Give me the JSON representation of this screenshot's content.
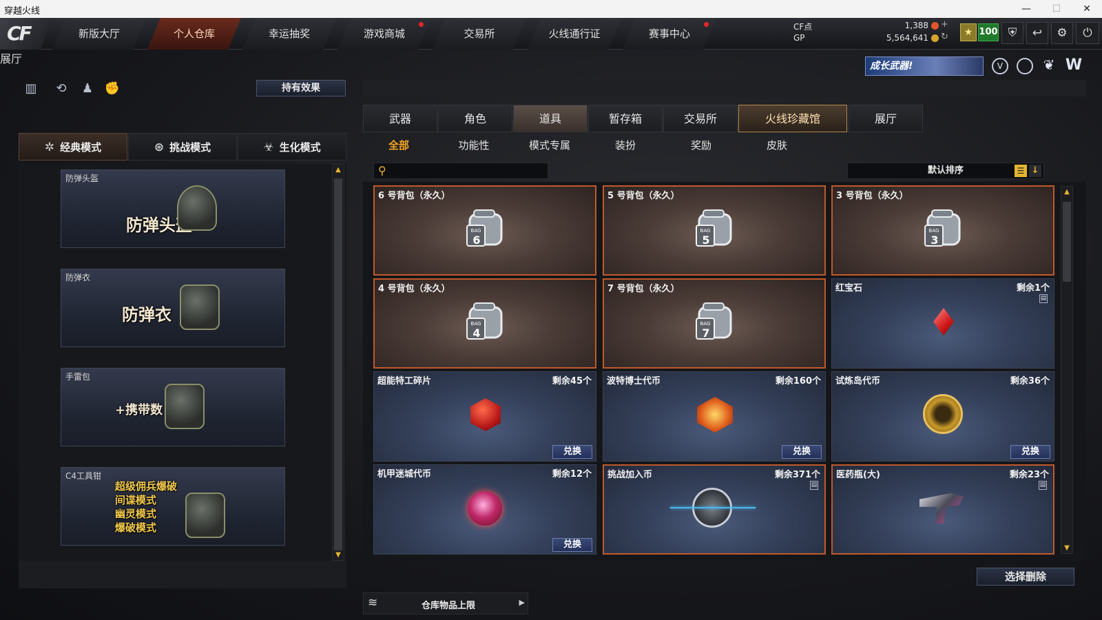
{
  "window": {
    "title": "穿越火线",
    "controls": {
      "minimize": "—",
      "maximize": "☐",
      "close": "✕"
    }
  },
  "logo": {
    "text": "CF"
  },
  "nav": {
    "tabs": [
      {
        "label": "新版大厅",
        "active": false,
        "dot": false
      },
      {
        "label": "个人仓库",
        "active": true,
        "dot": false
      },
      {
        "label": "幸运抽奖",
        "active": false,
        "dot": false
      },
      {
        "label": "游戏商城",
        "active": false,
        "dot": true
      },
      {
        "label": "交易所",
        "active": false,
        "dot": false
      },
      {
        "label": "火线通行证",
        "active": false,
        "dot": false
      },
      {
        "label": "赛事中心",
        "active": false,
        "dot": true
      }
    ]
  },
  "currency": {
    "cf_label": "CF点",
    "cf_value": "1,388",
    "gp_label": "GP",
    "gp_value": "5,564,641",
    "plus": "+",
    "level": "100"
  },
  "banner": {
    "text": "成长武器!"
  },
  "left": {
    "effect_button": "持有效果",
    "tabs": [
      {
        "label": "背包",
        "selected": false
      },
      {
        "label": "角色",
        "selected": false
      },
      {
        "label": "功能道具",
        "selected": true
      },
      {
        "label": "展厅",
        "selected": false
      }
    ],
    "modes": [
      {
        "label": "经典模式",
        "icon": "✲",
        "selected": true
      },
      {
        "label": "挑战模式",
        "icon": "⊛",
        "selected": false
      },
      {
        "label": "生化模式",
        "icon": "☣",
        "selected": false
      }
    ],
    "cards": [
      {
        "caption": "防弹头盔",
        "title": "防弹头盔"
      },
      {
        "caption": "防弹衣",
        "title": "防弹衣"
      },
      {
        "caption": "手雷包",
        "title": "+携带数"
      },
      {
        "caption": "C4工具钳",
        "lines": [
          "超级佣兵爆破",
          "间谍模式",
          "幽灵模式",
          "爆破模式"
        ]
      }
    ]
  },
  "right": {
    "tabs": [
      {
        "label": "武器",
        "style": ""
      },
      {
        "label": "角色",
        "style": ""
      },
      {
        "label": "道具",
        "style": "sel"
      },
      {
        "label": "暂存箱",
        "style": ""
      },
      {
        "label": "交易所",
        "style": ""
      },
      {
        "label": "火线珍藏馆",
        "style": "gold"
      },
      {
        "label": "展厅",
        "style": ""
      }
    ],
    "subtabs": [
      {
        "label": "全部",
        "selected": true
      },
      {
        "label": "功能性",
        "selected": false
      },
      {
        "label": "模式专属",
        "selected": false
      },
      {
        "label": "装扮",
        "selected": false
      },
      {
        "label": "奖励",
        "selected": false
      },
      {
        "label": "皮肤",
        "selected": false
      }
    ],
    "search_placeholder": "",
    "sort_label": "默认排序",
    "items": [
      {
        "name": "6 号背包（永久）",
        "remaining": "",
        "type": "bag",
        "bag": "6",
        "exchange": ""
      },
      {
        "name": "5 号背包（永久）",
        "remaining": "",
        "type": "bag",
        "bag": "5",
        "exchange": ""
      },
      {
        "name": "3 号背包（永久）",
        "remaining": "",
        "type": "bag",
        "bag": "3",
        "exchange": ""
      },
      {
        "name": "4 号背包（永久）",
        "remaining": "",
        "type": "bag",
        "bag": "4",
        "exchange": ""
      },
      {
        "name": "7 号背包（永久）",
        "remaining": "",
        "type": "bag",
        "bag": "7",
        "exchange": ""
      },
      {
        "name": "红宝石",
        "remaining": "剩余1个",
        "type": "ruby",
        "trash": true,
        "exchange": ""
      },
      {
        "name": "超能特工碎片",
        "remaining": "剩余45个",
        "type": "hex",
        "exchange": "兑换"
      },
      {
        "name": "波特博士代币",
        "remaining": "剩余160个",
        "type": "cube",
        "exchange": "兑换"
      },
      {
        "name": "试炼岛代币",
        "remaining": "剩余36个",
        "type": "medal",
        "exchange": "兑换"
      },
      {
        "name": "机甲迷城代币",
        "remaining": "剩余12个",
        "type": "orb",
        "exchange": "兑换"
      },
      {
        "name": "挑战加入币",
        "remaining": "剩余371个",
        "type": "pulse",
        "trash": true,
        "outline": true,
        "exchange": ""
      },
      {
        "name": "医药瓶(大)",
        "remaining": "剩余23个",
        "type": "gun",
        "trash": true,
        "outline": true,
        "exchange": ""
      }
    ],
    "delete_button": "选择删除",
    "storage_label": "仓库物品上限"
  }
}
